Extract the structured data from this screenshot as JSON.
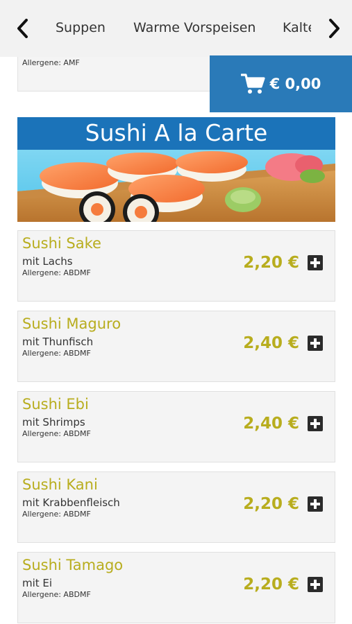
{
  "nav": {
    "categories": [
      "Suppen",
      "Warme Vorspeisen",
      "Kalte Vorspeisen"
    ]
  },
  "partial_item": {
    "allergens": "Allergene: AMF"
  },
  "cart": {
    "total": "€ 0,00",
    "icon": "shopping-cart-icon"
  },
  "section": {
    "title": "Sushi A la Carte"
  },
  "items": [
    {
      "name": "Sushi Sake",
      "description": "mit Lachs",
      "allergens": "Allergene: ABDMF",
      "price": "2,20 €"
    },
    {
      "name": "Sushi Maguro",
      "description": "mit Thunfisch",
      "allergens": "Allergene: ABDMF",
      "price": "2,40 €"
    },
    {
      "name": "Sushi Ebi",
      "description": "mit Shrimps",
      "allergens": "Allergene: ABDMF",
      "price": "2,40 €"
    },
    {
      "name": "Sushi Kani",
      "description": "mit Krabbenfleisch",
      "allergens": "Allergene: ABDMF",
      "price": "2,20 €"
    },
    {
      "name": "Sushi Tamago",
      "description": "mit Ei",
      "allergens": "Allergene: ABDMF",
      "price": "2,20 €"
    }
  ],
  "colors": {
    "accent_blue": "#1b73b9",
    "cart_blue": "#2a7ab8",
    "item_name_gold": "#b8ad1e",
    "card_bg": "#f4f4f4"
  }
}
